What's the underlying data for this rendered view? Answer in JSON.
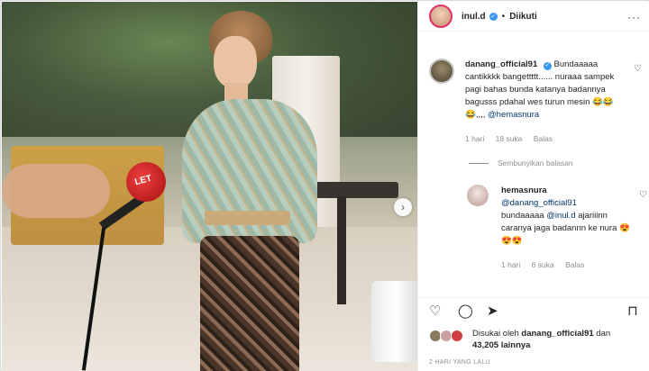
{
  "post": {
    "author": "inul.d",
    "follow_status": "Diikuti",
    "separator": "•",
    "more_icon": "more-horizontal-icon",
    "mic_brand": "LET",
    "next_icon": "chevron-right-icon"
  },
  "comments": [
    {
      "user": "danang_official91",
      "verified": true,
      "text": "Bundaaaaa cantikkkk bangettttt...... nuraaa sampek pagi bahas bunda katanya badannya bagusss pdahal wes turun mesin 😂😂😂,,,,",
      "mention": "@hemasnura",
      "time": "1 hari",
      "likes": "18 suka",
      "reply_label": "Balas"
    },
    {
      "user": "hemasnura",
      "verified": false,
      "text_prefix": "@danang_official91",
      "text_mid": "bundaaaaa",
      "mention": "@inul.d",
      "text": "ajariiinn caranya jaga badannn ke nura 😍😍😍",
      "time": "1 hari",
      "likes": "6 suka",
      "reply_label": "Balas"
    }
  ],
  "hide_replies": "Sembunyikan balasan",
  "likes_summary": {
    "prefix": "Disukai oleh",
    "user": "danang_official91",
    "middle": "dan",
    "count": "43,205",
    "suffix": "lainnya"
  },
  "time_ago": "2 HARI YANG LALU",
  "colors": {
    "verified": "#3897f0",
    "mention": "#00376b",
    "muted": "#8e8e8e"
  }
}
